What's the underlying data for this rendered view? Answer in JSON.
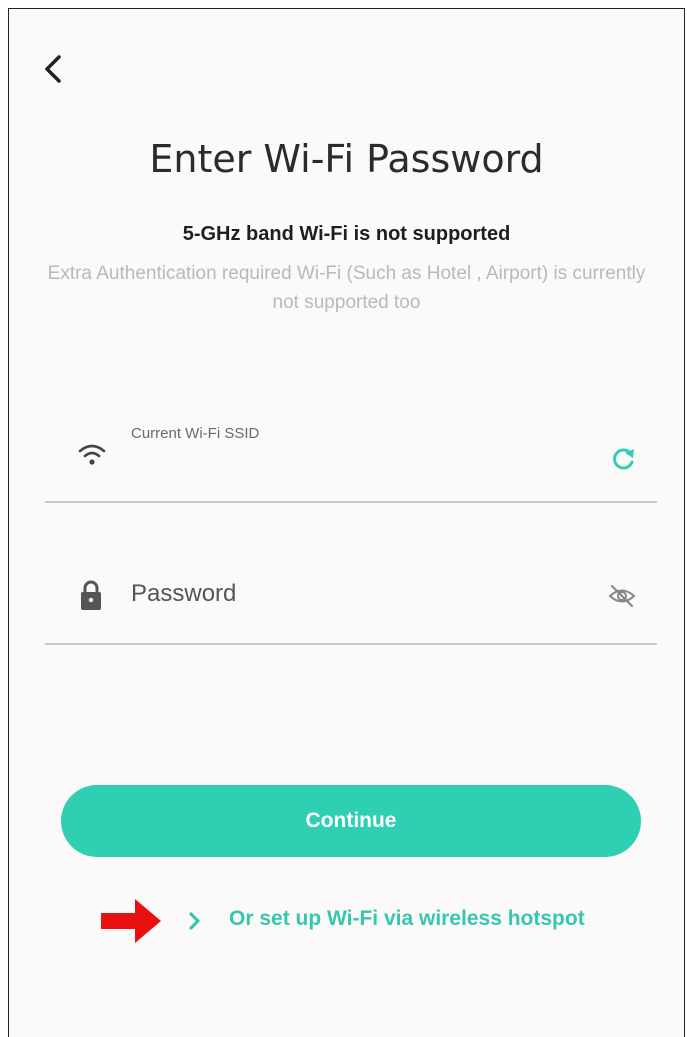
{
  "colors": {
    "accent": "#2fcfb3",
    "link": "#35c7b0",
    "annotation_arrow": "#e81010"
  },
  "header": {
    "title": "Enter Wi-Fi Password"
  },
  "info": {
    "warning": "5-GHz band Wi-Fi is not supported",
    "note": "Extra Authentication required Wi-Fi (Such as Hotel , Airport) is currently not supported too"
  },
  "ssid_field": {
    "label": "Current Wi-Fi SSID",
    "value": "",
    "icon": "wifi-icon",
    "action_icon": "refresh-icon"
  },
  "password_field": {
    "placeholder": "Password",
    "value": "",
    "icon": "lock-icon",
    "toggle_icon": "eye-off-icon"
  },
  "continue_button": {
    "label": "Continue"
  },
  "hotspot_link": {
    "label": "Or set up Wi-Fi via wireless hotspot",
    "icon": "chevron-right-icon"
  },
  "annotation": {
    "icon": "red-arrow-icon"
  }
}
